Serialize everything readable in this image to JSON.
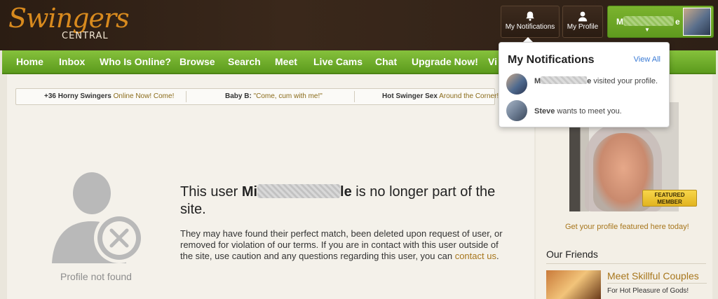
{
  "brand": {
    "logo_script": "Swingers",
    "logo_sub": "CENTRAL",
    "accent_color": "#6aa726",
    "link_color": "#a7761c"
  },
  "header": {
    "notifications_label": "My Notifications",
    "profile_label": "My Profile",
    "user_name_start": "M",
    "user_name_end": "e"
  },
  "nav": {
    "items": [
      "Home",
      "Inbox",
      "Who Is Online?",
      "Browse",
      "Search",
      "Meet",
      "Live Cams",
      "Chat",
      "Upgrade Now!",
      "Vi"
    ]
  },
  "ticker": {
    "items": [
      {
        "bold": "+36 Horny Swingers",
        "rest": " Online Now! Come!"
      },
      {
        "bold": "Baby B:",
        "rest": " \"Come, cum with me!\""
      },
      {
        "bold": "Hot Swinger Sex",
        "rest": " Around the Corner!"
      }
    ]
  },
  "main": {
    "profile_not_found": "Profile not found",
    "title_prefix": "This user ",
    "title_name_start": "Mi",
    "title_name_end": "le",
    "title_suffix": " is no longer part of the site.",
    "body": "They may have found their perfect match, been deleted upon request of user, or removed for violation of our terms. If you are in contact with this user outside of the site, use caution and any questions regarding this user, you can ",
    "contact_link": "contact us",
    "body_end": "."
  },
  "sidebar": {
    "featured_badge": "FEATURED MEMBER",
    "featured_cta": "Get your profile featured here today!",
    "friends_title": "Our Friends",
    "friend_name": "Meet Skillful Couples",
    "friend_desc": "For Hot Pleasure of Gods!"
  },
  "notifications": {
    "title": "My Notifications",
    "view_all": "View All",
    "items": [
      {
        "name_start": "M",
        "name_end": "e",
        "text": " visited your profile."
      },
      {
        "name": "Steve",
        "text": " wants to meet you."
      }
    ]
  },
  "icons": {
    "notifications": "bell-icon",
    "profile": "person-icon",
    "profile_missing": "user-removed-icon"
  }
}
